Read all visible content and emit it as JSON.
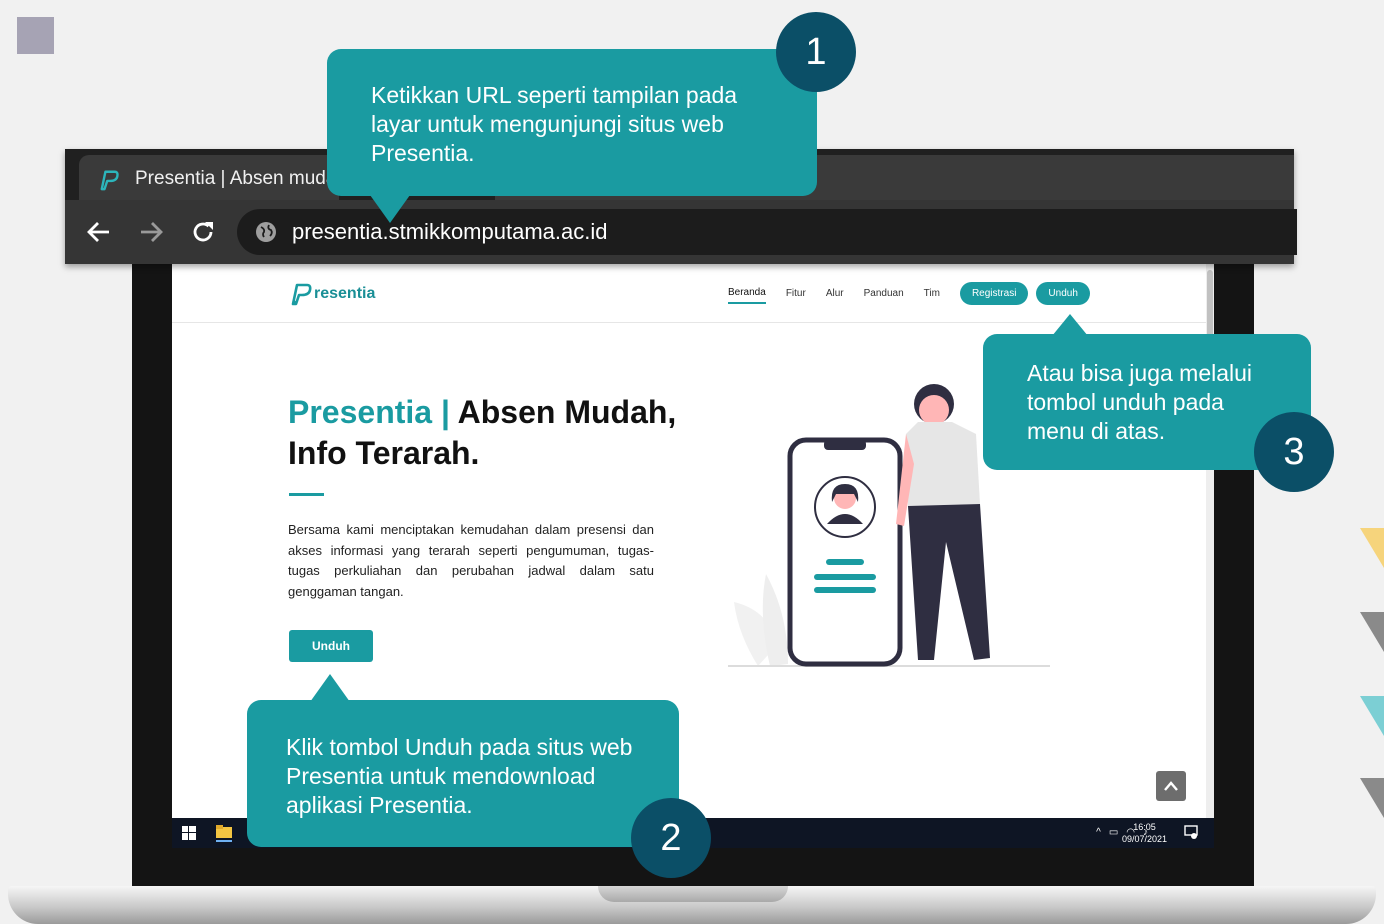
{
  "browser": {
    "tab_title": "Presentia | Absen muda",
    "url": "presentia.stmikkomputama.ac.id"
  },
  "site": {
    "logo_text": "resentia",
    "nav": [
      "Beranda",
      "Fitur",
      "Alur",
      "Panduan",
      "Tim"
    ],
    "register_label": "Registrasi",
    "download_label": "Unduh",
    "hero_title_accent": "Presentia |",
    "hero_title_rest": " Absen Mudah, Info Terarah.",
    "hero_description": "Bersama kami menciptakan kemudahan dalam presensi dan akses informasi yang terarah seperti pengumuman, tugas-tugas perkuliahan dan perubahan jadwal dalam satu genggaman tangan.",
    "hero_button": "Unduh"
  },
  "taskbar": {
    "time": "16:05",
    "date": "09/07/2021"
  },
  "callouts": [
    {
      "number": "1",
      "text": "Ketikkan URL seperti tampilan pada layar untuk mengunjungi situs web Presentia."
    },
    {
      "number": "2",
      "text": "Klik tombol Unduh pada situs web Presentia untuk mendownload aplikasi Presentia."
    },
    {
      "number": "3",
      "text": "Atau bisa juga melalui tombol unduh pada menu di atas."
    }
  ],
  "colors": {
    "accent": "#1a9ba1",
    "badge": "#0b4f67",
    "deco_yellow": "#f6d47c",
    "deco_gray": "#8a8a8a",
    "deco_teal": "#7ccfd4"
  }
}
